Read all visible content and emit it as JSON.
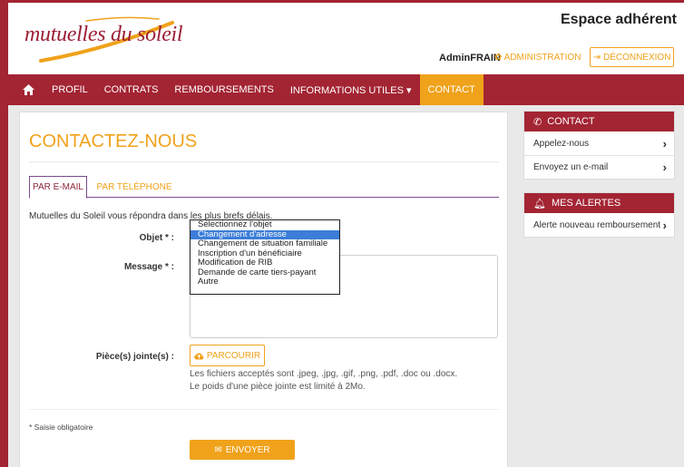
{
  "header": {
    "logo_text": "mutuelles du soleil",
    "space_title": "Espace adhérent",
    "user_name": "AdminFRAIN",
    "admin_link": "ADMINISTRATION",
    "logout_label": "DÉCONNEXION"
  },
  "nav": {
    "items": [
      "PROFIL",
      "CONTRATS",
      "REMBOURSEMENTS",
      "INFORMATIONS UTILES ▾",
      "CONTACT"
    ],
    "active": "CONTACT"
  },
  "main": {
    "title": "CONTACTEZ-NOUS",
    "tabs": [
      "PAR E-MAIL",
      "PAR TÉLÉPHONE"
    ],
    "intro": "Mutuelles du Soleil vous répondra dans les plus brefs délais.",
    "labels": {
      "object": "Objet * :",
      "message": "Message * :",
      "attachments": "Pièce(s) jointe(s) :"
    },
    "select_options": [
      "Sélectionnez l'objet",
      "Changement d'adresse",
      "Changement de situation familiale",
      "Inscription d'un bénéficiaire",
      "Modification de RIB",
      "Demande de carte tiers-payant",
      "Autre"
    ],
    "select_highlighted_index": 1,
    "browse_label": "PARCOURIR",
    "hint_1": "Les fichiers acceptés sont .jpeg, .jpg, .gif, .png, .pdf, .doc ou .docx.",
    "hint_2": "Le poids d'une pièce jointe est limité à 2Mo.",
    "required_note": "* Saisie obligatoire",
    "send_label": "ENVOYER"
  },
  "sidebar": {
    "contact": {
      "title": "CONTACT",
      "items": [
        "Appelez-nous",
        "Envoyez un e-mail"
      ]
    },
    "alerts": {
      "title": "MES ALERTES",
      "items": [
        "Alerte nouveau remboursement"
      ]
    }
  },
  "colors": {
    "brand_red": "#a32433",
    "accent_orange": "#f0a21b",
    "tab_purple": "#7a4a8f",
    "highlight_blue": "#3b7dd8"
  }
}
